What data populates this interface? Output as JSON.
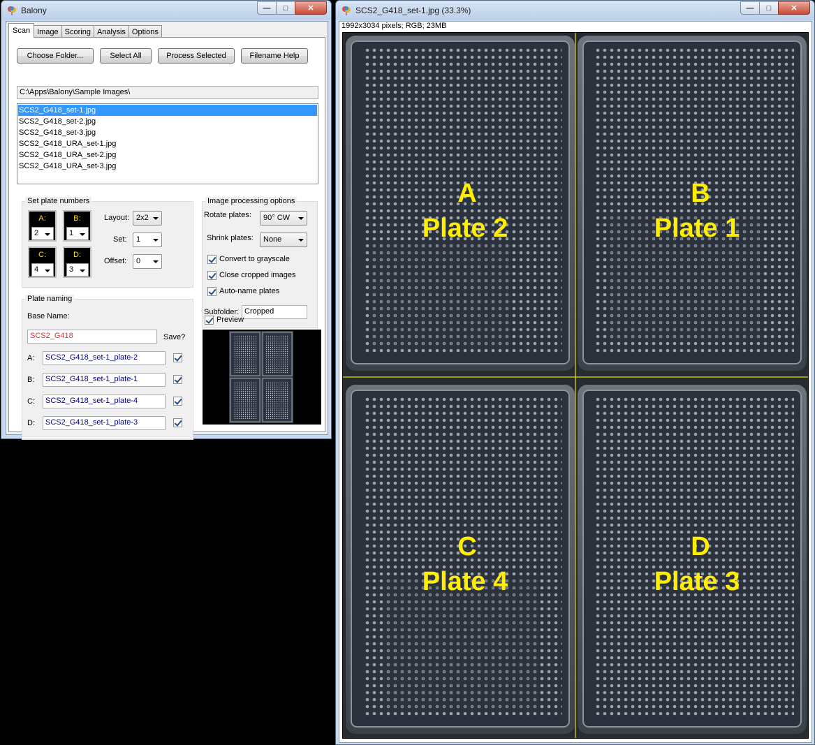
{
  "left_window": {
    "title": "Balony",
    "tabs": [
      "Scan",
      "Image",
      "Scoring",
      "Analysis",
      "Options"
    ],
    "buttons": {
      "choose_folder": "Choose Folder...",
      "select_all": "Select All",
      "process_selected": "Process Selected",
      "filename_help": "Filename Help"
    },
    "folder_path": "C:\\Apps\\Balony\\Sample Images\\",
    "files": [
      {
        "name": "SCS2_G418_set-1.jpg",
        "selected": true
      },
      {
        "name": "SCS2_G418_set-2.jpg",
        "selected": false
      },
      {
        "name": "SCS2_G418_set-3.jpg",
        "selected": false
      },
      {
        "name": "SCS2_G418_URA_set-1.jpg",
        "selected": false
      },
      {
        "name": "SCS2_G418_URA_set-2.jpg",
        "selected": false
      },
      {
        "name": "SCS2_G418_URA_set-3.jpg",
        "selected": false
      }
    ],
    "plate_numbers": {
      "title": "Set plate numbers",
      "plates": [
        {
          "label": "A:",
          "value": "2"
        },
        {
          "label": "B:",
          "value": "1"
        },
        {
          "label": "C:",
          "value": "4"
        },
        {
          "label": "D:",
          "value": "3"
        }
      ],
      "layout_label": "Layout:",
      "layout_value": "2x2",
      "set_label": "Set:",
      "set_value": "1",
      "offset_label": "Offset:",
      "offset_value": "0"
    },
    "processing": {
      "title": "Image processing options",
      "rotate_label": "Rotate plates:",
      "rotate_value": "90° CW",
      "shrink_label": "Shrink plates:",
      "shrink_value": "None",
      "convert_grayscale": "Convert to grayscale",
      "close_cropped": "Close cropped images",
      "auto_name": "Auto-name plates",
      "subfolder_label": "Subfolder:",
      "subfolder_value": "Cropped"
    },
    "naming": {
      "title": "Plate naming",
      "base_name_label": "Base Name:",
      "base_name_value": "SCS2_G418",
      "save_label": "Save?",
      "rows": [
        {
          "label": "A:",
          "value": "SCS2_G418_set-1_plate-2"
        },
        {
          "label": "B:",
          "value": "SCS2_G418_set-1_plate-1"
        },
        {
          "label": "C:",
          "value": "SCS2_G418_set-1_plate-4"
        },
        {
          "label": "D:",
          "value": "SCS2_G418_set-1_plate-3"
        }
      ]
    },
    "preview_label": "Preview"
  },
  "right_window": {
    "title": "SCS2_G418_set-1.jpg (33.3%)",
    "info": "1992x3034 pixels; RGB; 23MB",
    "quadrants": [
      {
        "letter": "A",
        "plate": "Plate 2"
      },
      {
        "letter": "B",
        "plate": "Plate 1"
      },
      {
        "letter": "C",
        "plate": "Plate 4"
      },
      {
        "letter": "D",
        "plate": "Plate 3"
      }
    ],
    "label_color": "#ffee00",
    "divider_color": "#e8e000"
  }
}
